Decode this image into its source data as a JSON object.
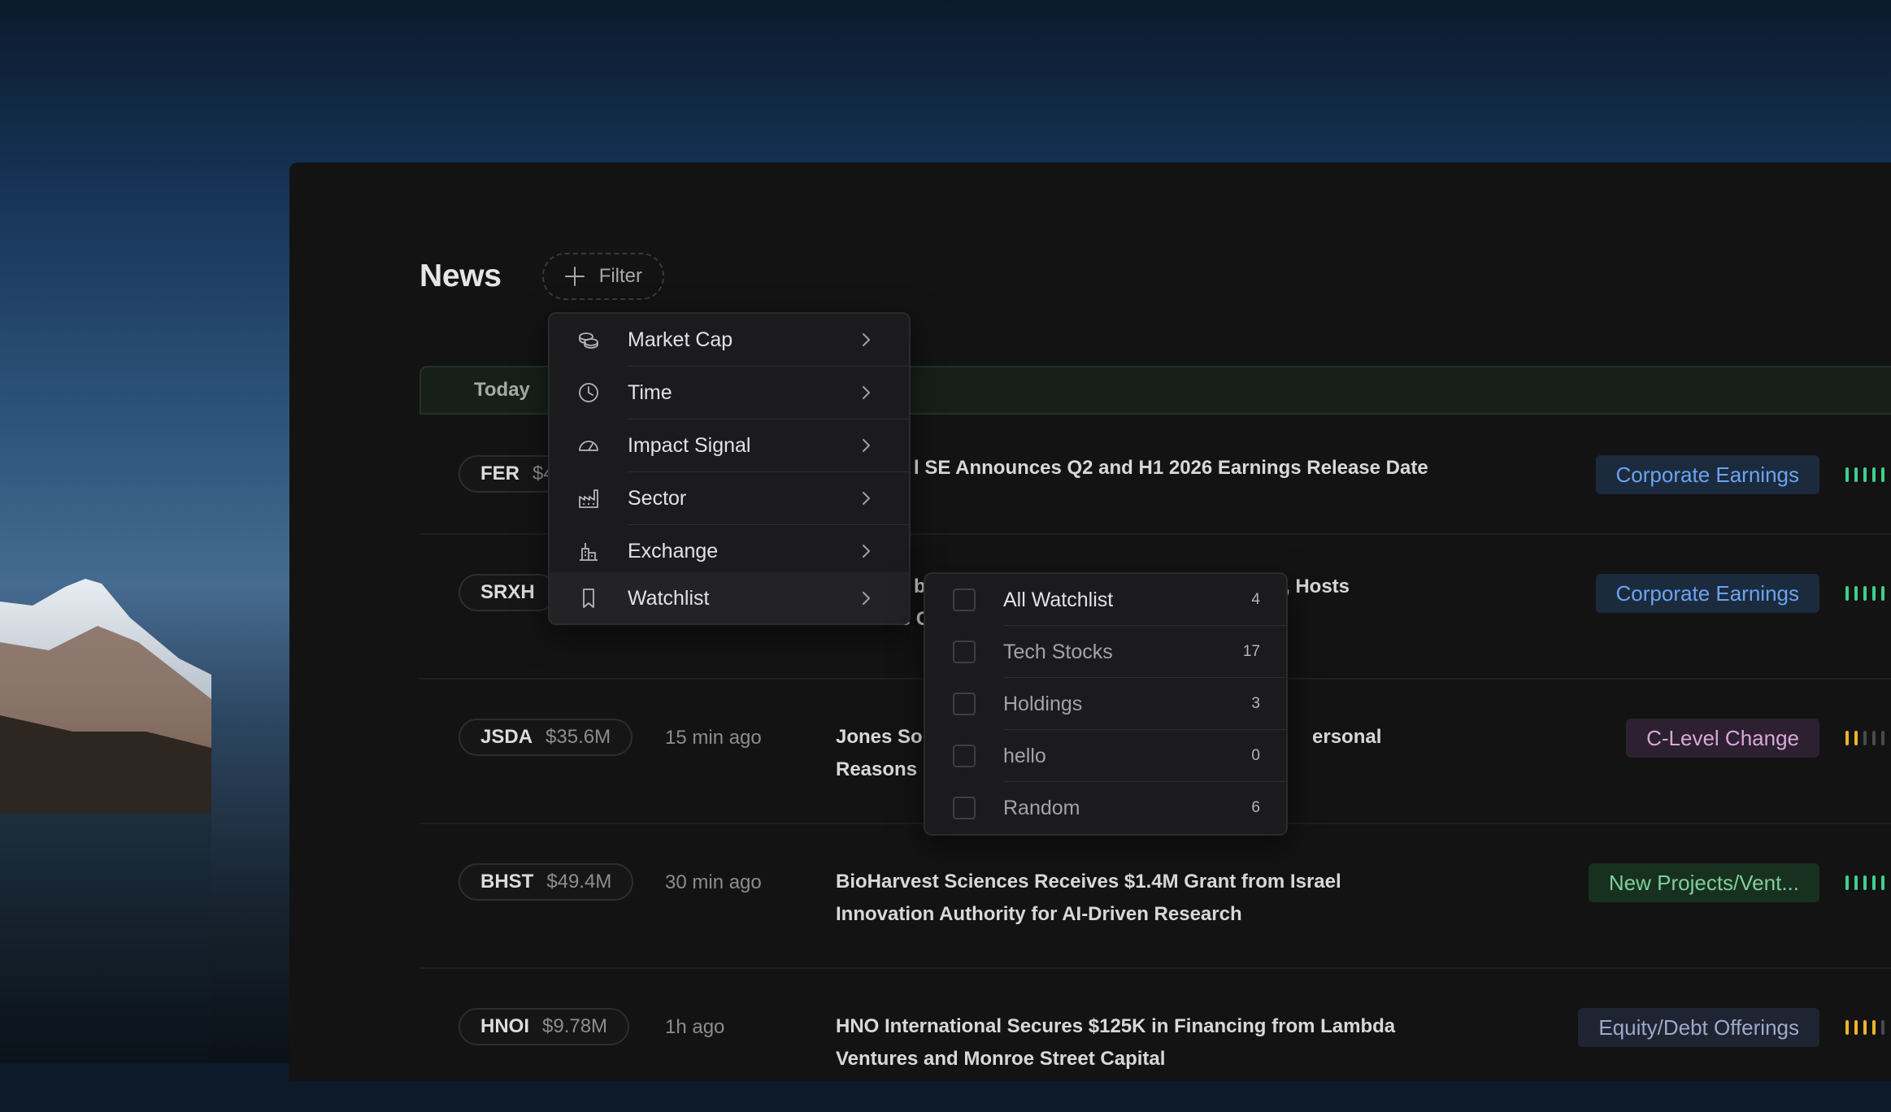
{
  "header": {
    "title": "News",
    "filter_label": "Filter"
  },
  "today_label": "Today",
  "filter_menu": [
    {
      "label": "Market Cap",
      "icon": "coins-icon"
    },
    {
      "label": "Time",
      "icon": "clock-icon"
    },
    {
      "label": "Impact Signal",
      "icon": "gauge-icon"
    },
    {
      "label": "Sector",
      "icon": "factory-icon"
    },
    {
      "label": "Exchange",
      "icon": "bank-icon"
    },
    {
      "label": "Watchlist",
      "icon": "bookmark-icon"
    }
  ],
  "watchlist_submenu": [
    {
      "label": "All Watchlist",
      "count": "4"
    },
    {
      "label": "Tech Stocks",
      "count": "17"
    },
    {
      "label": "Holdings",
      "count": "3"
    },
    {
      "label": "hello",
      "count": "0"
    },
    {
      "label": "Random",
      "count": "6"
    }
  ],
  "news": [
    {
      "ticker": "FER",
      "mcap": "$4",
      "time": "",
      "headline_line1": "l SE Announces Q2 and H1 2026 Earnings Release Date",
      "headline_line2": "",
      "tag": "Corporate Earnings",
      "signal_level": 5
    },
    {
      "ticker": "SRXH",
      "mcap": "",
      "time": "",
      "headline_line1": "b",
      "headline_line1b": "eturn, Hosts",
      "headline_line2": "Fireside C",
      "tag": "Corporate Earnings",
      "signal_level": 5
    },
    {
      "ticker": "JSDA",
      "mcap": "$35.6M",
      "time": "15 min ago",
      "headline_line1": "Jones So",
      "headline_line1b": "ersonal",
      "headline_line2": "Reasons",
      "tag": "C-Level Change",
      "signal_level": 2
    },
    {
      "ticker": "BHST",
      "mcap": "$49.4M",
      "time": "30 min ago",
      "headline_line1": "BioHarvest Sciences Receives $1.4M Grant from Israel",
      "headline_line2": "Innovation Authority for AI-Driven Research",
      "tag": "New Projects/Vent...",
      "signal_level": 5
    },
    {
      "ticker": "HNOI",
      "mcap": "$9.78M",
      "time": "1h ago",
      "headline_line1": "HNO International Secures $125K in Financing from Lambda",
      "headline_line2": "Ventures and Monroe Street Capital",
      "tag": "Equity/Debt Offerings",
      "signal_level": 4
    }
  ],
  "colors": {
    "earnings_bg": "#1c2a3e",
    "earnings_fg": "#6aa4f0",
    "clevel_bg": "#2d2030",
    "clevel_fg": "#d9a7d8",
    "projects_bg": "#18301f",
    "projects_fg": "#7fcf98",
    "equity_bg": "#1f2432",
    "equity_fg": "#9da9c9",
    "signal_green": "#3ecf8e",
    "signal_yellow": "#f0b429",
    "signal_off": "#4a4a4e"
  }
}
